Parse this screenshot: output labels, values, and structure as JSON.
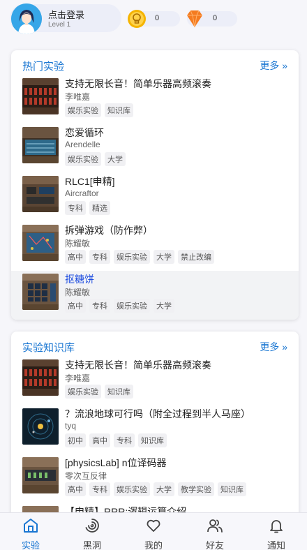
{
  "header": {
    "login_title": "点击登录",
    "level": "Level 1",
    "coins": "0",
    "gems": "0"
  },
  "colors": {
    "accent": "#1976d2",
    "selected_title": "#1e4de0",
    "background": "#f6f6fa",
    "coin": "#f5b400",
    "gem": "#f47b20"
  },
  "hot": {
    "title": "热门实验",
    "more": "更多 »",
    "items": [
      {
        "title": "支持无限长音！简单乐器高频滚奏",
        "author": "李唯嘉",
        "tags": [
          "娱乐实验",
          "知识库"
        ]
      },
      {
        "title": "恋爱循环",
        "author": "Arendelle",
        "tags": [
          "娱乐实验",
          "大学"
        ]
      },
      {
        "title": "RLC1[申精]",
        "author": "Aircraftor",
        "tags": [
          "专科",
          "精选"
        ]
      },
      {
        "title": "拆弹游戏（防作弊）",
        "author": "陈耀敏",
        "tags": [
          "高中",
          "专科",
          "娱乐实验",
          "大学",
          "禁止改编"
        ]
      },
      {
        "title": "抠糖饼",
        "author": "陈耀敏",
        "tags": [
          "高中",
          "专科",
          "娱乐实验",
          "大学"
        ]
      }
    ]
  },
  "knowledge": {
    "title": "实验知识库",
    "more": "更多 »",
    "items": [
      {
        "title": "支持无限长音！简单乐器高频滚奏",
        "author": "李唯嘉",
        "tags": [
          "娱乐实验",
          "知识库"
        ]
      },
      {
        "title": "？流浪地球可行吗（附全过程到半人马座）",
        "author": "tyq",
        "tags": [
          "初中",
          "高中",
          "专科",
          "知识库"
        ]
      },
      {
        "title": "[physicsLab] n位译码器",
        "author": "零次互反律",
        "tags": [
          "高中",
          "专科",
          "娱乐实验",
          "大学",
          "教学实验",
          "知识库"
        ]
      },
      {
        "title": "【申精】RRR:逻辑运算介绍",
        "author": "",
        "tags": []
      }
    ]
  },
  "nav": [
    {
      "label": "实验",
      "icon": "home-icon",
      "active": true
    },
    {
      "label": "黑洞",
      "icon": "blackhole-icon",
      "active": false
    },
    {
      "label": "我的",
      "icon": "heart-icon",
      "active": false
    },
    {
      "label": "好友",
      "icon": "friends-icon",
      "active": false
    },
    {
      "label": "通知",
      "icon": "bell-icon",
      "active": false
    }
  ]
}
